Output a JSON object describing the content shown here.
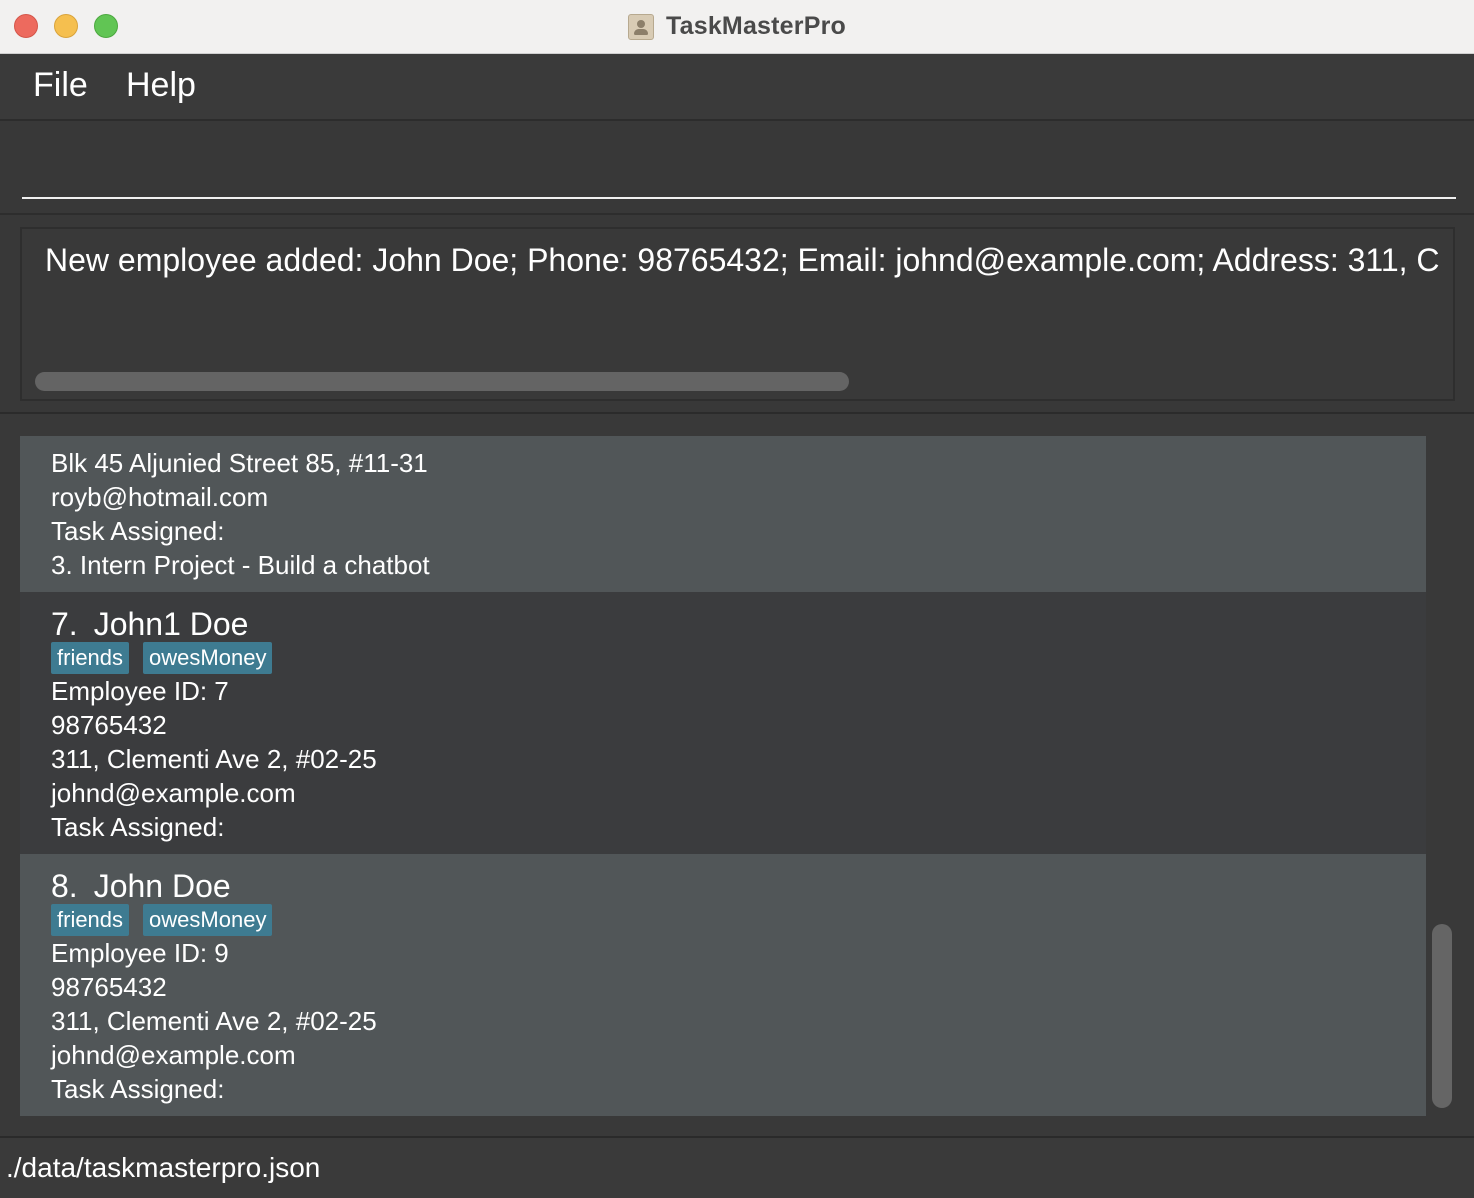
{
  "window": {
    "title": "TaskMasterPro"
  },
  "menu": {
    "file": "File",
    "help": "Help"
  },
  "command": {
    "value": "",
    "placeholder": ""
  },
  "result": {
    "message": "New employee added: John Doe; Phone: 98765432; Email: johnd@example.com; Address: 311, C"
  },
  "employees": [
    {
      "address": "Blk 45 Aljunied Street 85, #11-31",
      "email": "royb@hotmail.com",
      "task_label": "Task Assigned:",
      "tasks": [
        "3. Intern Project - Build a chatbot"
      ]
    },
    {
      "index": "7.",
      "name": "John1 Doe",
      "tags": [
        "friends",
        "owesMoney"
      ],
      "employee_id": "Employee ID: 7",
      "phone": "98765432",
      "address": "311, Clementi Ave 2, #02-25",
      "email": "johnd@example.com",
      "task_label": "Task Assigned:"
    },
    {
      "index": "8.",
      "name": "John Doe",
      "tags": [
        "friends",
        "owesMoney"
      ],
      "employee_id": "Employee ID: 9",
      "phone": "98765432",
      "address": "311, Clementi Ave 2, #02-25",
      "email": "johnd@example.com",
      "task_label": "Task Assigned:"
    }
  ],
  "status": {
    "file_path": "./data/taskmasterpro.json"
  },
  "colors": {
    "card_even": "#515658",
    "card_odd": "#3b3c3e",
    "tag_bg": "#3e7b91"
  }
}
